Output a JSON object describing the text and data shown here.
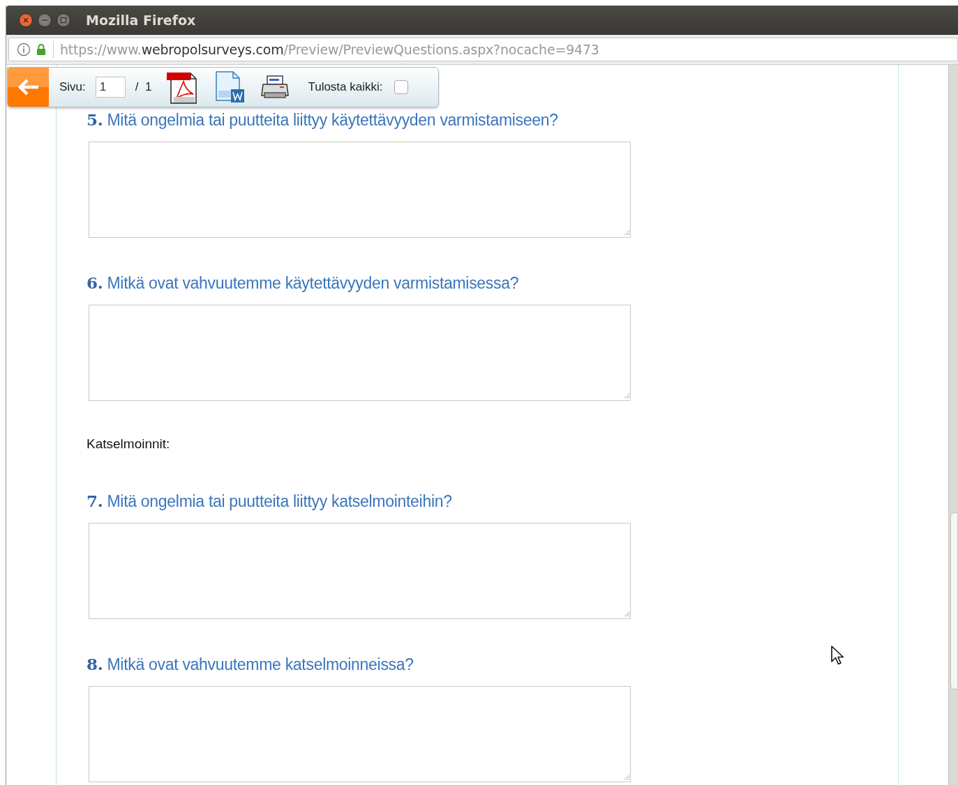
{
  "window": {
    "title": "Mozilla Firefox"
  },
  "address_bar": {
    "scheme": "https://www.",
    "domain": "webropolsurveys.com",
    "path": "/Preview/PreviewQuestions.aspx?nocache=9473"
  },
  "toolbar": {
    "page_label": "Sivu:",
    "page_value": "1",
    "page_total": "/  1",
    "print_all_label": "Tulosta kaikki:",
    "print_all_checked": false
  },
  "items": [
    {
      "kind": "question",
      "number": "5.",
      "text": "Mitä ongelmia tai puutteita liittyy käytettävyyden varmistamiseen?"
    },
    {
      "kind": "question",
      "number": "6.",
      "text": "Mitkä ovat vahvuutemme käytettävyyden varmistamisessa?"
    },
    {
      "kind": "section",
      "text": "Katselmoinnit:"
    },
    {
      "kind": "question",
      "number": "7.",
      "text": "Mitä ongelmia tai puutteita liittyy katselmointeihin?"
    },
    {
      "kind": "question",
      "number": "8.",
      "text": "Mitkä ovat vahvuutemme katselmoinneissa?"
    }
  ]
}
